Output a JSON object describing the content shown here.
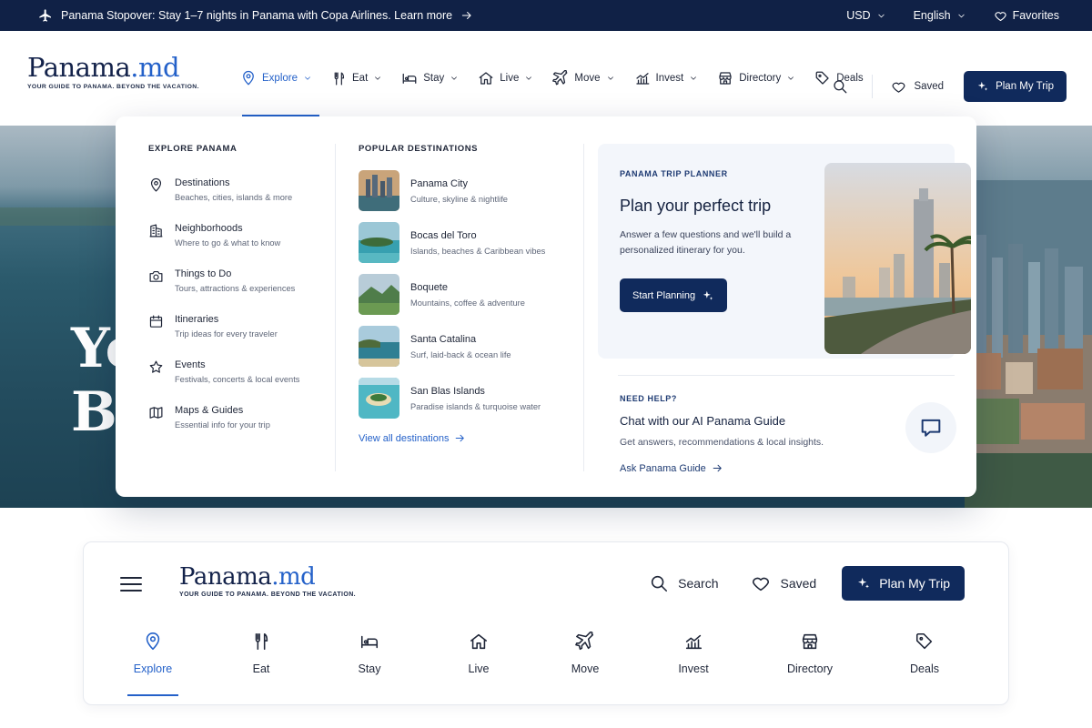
{
  "topbar": {
    "promo": "Panama Stopover: Stay 1–7 nights in Panama with Copa Airlines. Learn more",
    "currency": "USD",
    "language": "English",
    "favorites": "Favorites"
  },
  "brand": {
    "name_main": "Panama",
    "name_dot": ".",
    "name_suffix": "md",
    "tagline": "YOUR GUIDE TO PANAMA. BEYOND THE VACATION."
  },
  "nav": {
    "items": [
      {
        "label": "Explore",
        "icon": "map-pin-icon",
        "active": true
      },
      {
        "label": "Eat",
        "icon": "fork-knife-icon"
      },
      {
        "label": "Stay",
        "icon": "bed-icon"
      },
      {
        "label": "Live",
        "icon": "home-icon"
      },
      {
        "label": "Move",
        "icon": "plane-icon"
      },
      {
        "label": "Invest",
        "icon": "chart-icon"
      },
      {
        "label": "Directory",
        "icon": "storefront-icon"
      },
      {
        "label": "Deals",
        "icon": "tag-icon"
      }
    ],
    "saved": "Saved",
    "plan_button": "Plan My Trip"
  },
  "hero": {
    "line1": "Yo",
    "line2": "Be"
  },
  "dropdown": {
    "explore": {
      "title": "EXPLORE PANAMA",
      "items": [
        {
          "title": "Destinations",
          "sub": "Beaches, cities, islands & more"
        },
        {
          "title": "Neighborhoods",
          "sub": "Where to go & what to know"
        },
        {
          "title": "Things to Do",
          "sub": "Tours, attractions & experiences"
        },
        {
          "title": "Itineraries",
          "sub": "Trip ideas for every traveler"
        },
        {
          "title": "Events",
          "sub": "Festivals, concerts & local events"
        },
        {
          "title": "Maps & Guides",
          "sub": "Essential info for your trip"
        }
      ]
    },
    "popular": {
      "title": "POPULAR DESTINATIONS",
      "items": [
        {
          "title": "Panama City",
          "sub": "Culture, skyline & nightlife"
        },
        {
          "title": "Bocas del Toro",
          "sub": "Islands, beaches & Caribbean vibes"
        },
        {
          "title": "Boquete",
          "sub": "Mountains, coffee & adventure"
        },
        {
          "title": "Santa Catalina",
          "sub": "Surf, laid-back & ocean life"
        },
        {
          "title": "San Blas Islands",
          "sub": "Paradise islands & turquoise water"
        }
      ],
      "view_all": "View all destinations"
    },
    "planner": {
      "kicker": "PANAMA TRIP PLANNER",
      "heading": "Plan your perfect trip",
      "text": "Answer a few questions and we'll build a personalized itinerary for you.",
      "button": "Start Planning"
    },
    "help": {
      "kicker": "NEED HELP?",
      "heading": "Chat with our AI Panama Guide",
      "text": "Get answers, recommendations & local insights.",
      "link": "Ask Panama Guide"
    }
  },
  "mobile_header": {
    "search": "Search",
    "saved": "Saved",
    "plan_button": "Plan My Trip",
    "tabs": [
      {
        "label": "Explore",
        "active": true
      },
      {
        "label": "Eat"
      },
      {
        "label": "Stay"
      },
      {
        "label": "Live"
      },
      {
        "label": "Move"
      },
      {
        "label": "Invest"
      },
      {
        "label": "Directory"
      },
      {
        "label": "Deals"
      }
    ]
  },
  "colors": {
    "navy": "#102A5C",
    "accent_blue": "#2461C9",
    "topbar_bg": "#102146"
  }
}
